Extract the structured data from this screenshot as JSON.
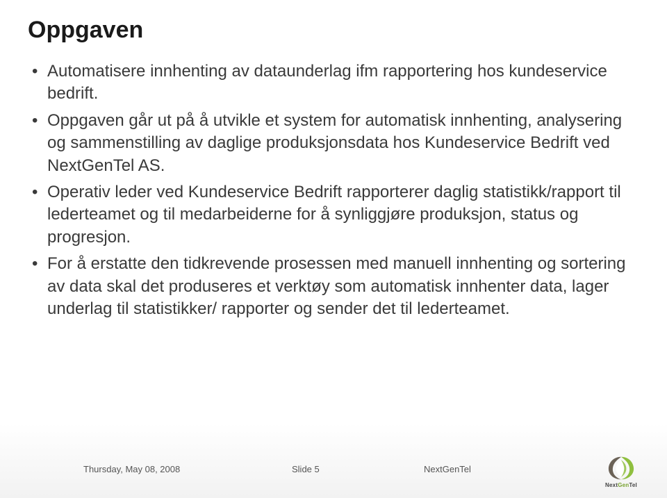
{
  "title": "Oppgaven",
  "bullets": [
    "Automatisere innhenting av dataunderlag ifm rapportering hos kundeservice bedrift.",
    "Oppgaven går ut på å utvikle et system for automatisk innhenting, analysering og sammenstilling av daglige produksjonsdata hos Kundeservice Bedrift ved NextGenTel AS.",
    "Operativ leder ved Kundeservice Bedrift rapporterer daglig statistikk/rapport til lederteamet og til medarbeiderne for å synliggjøre produksjon, status og progresjon.",
    "For å erstatte den tidkrevende prosessen med manuell innhenting og sortering av data skal det produseres et verktøy som automatisk innhenter data, lager underlag til statistikker/ rapporter og sender det til lederteamet."
  ],
  "footer": {
    "date": "Thursday, May 08, 2008",
    "slide_label": "Slide 5",
    "company": "NextGenTel"
  },
  "logo": {
    "brand_prefix": "Next",
    "brand_green": "Gen",
    "brand_suffix": "Tel"
  }
}
